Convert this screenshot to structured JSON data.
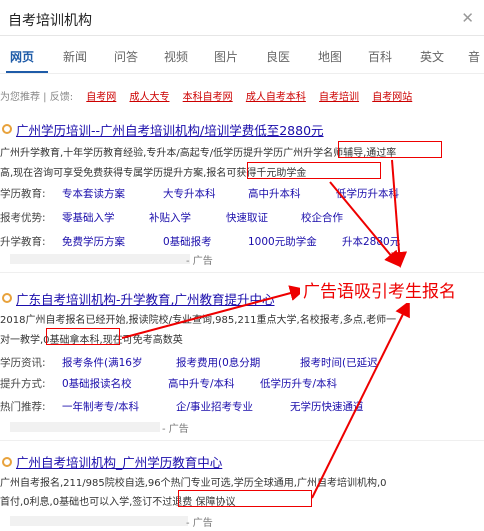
{
  "search": {
    "query": "自考培训机构",
    "clear_icon": "close-icon"
  },
  "tabs": [
    "网页",
    "新闻",
    "问答",
    "视频",
    "图片",
    "良医",
    "地图",
    "百科",
    "英文",
    "音"
  ],
  "recommend": {
    "label": "为您推荐 | 反馈:",
    "items": [
      "自考网",
      "成人大专",
      "本科自考网",
      "成人自考本科",
      "自考培训",
      "自考网站"
    ]
  },
  "results": [
    {
      "title": "广州学历培训--广州自考培训机构/培训学费低至2880元",
      "snip1": "广州升学教育,十年学历教育经验,专升本/高起专/低学历提升学历广州升学名师辅导,通过率",
      "snip2": "高,现在咨询可享受免费获得专属学历提升方案,报名可获得千元助学金",
      "rows": [
        {
          "label": "学历教育:",
          "links": [
            "专本套读方案",
            "大专升本科",
            "高中升本科",
            "低学历升本科"
          ]
        },
        {
          "label": "报考优势:",
          "links": [
            "零基础入学",
            "补贴入学",
            "快速取证",
            "校企合作"
          ]
        },
        {
          "label": "升学教育:",
          "links": [
            "免费学历方案",
            "0基础报考",
            "1000元助学金",
            "升本2880元"
          ]
        }
      ],
      "footer": "- 广告"
    },
    {
      "title": "广东自考培训机构-升学教育,广州教育提升中心",
      "snip1": "2018广州自考报名已经开始,报读院校/专业查询,985,211重点大学,名校报考,多点,老师一",
      "snip2": "对一教学,0基础拿本科,现在可免考高数英",
      "rows": [
        {
          "label": "学历资讯:",
          "links": [
            "报考条件(满16岁",
            "报考费用(0息分期",
            "报考时间(已延迟"
          ]
        },
        {
          "label": "提升方式:",
          "links": [
            "0基础报读名校",
            "高中升专/本科",
            "低学历升专/本科"
          ]
        },
        {
          "label": "热门推荐:",
          "links": [
            "一年制考专/本科",
            "企/事业招考专业",
            "无学历快速通道"
          ]
        }
      ],
      "footer": "- 广告"
    },
    {
      "title": "广州自考培训机构_广州学历教育中心",
      "snip1": "广州自考报名,211/985院校自选,96个热门专业可选,学历全球通用,广州自考培训机构,0",
      "snip2": "首付,0利息,0基础也可以入学,签订不过退费 保障协议",
      "footer": "- 广告"
    }
  ],
  "annotation": "广告语吸引考生报名",
  "colors": {
    "link": "#1a0dab",
    "accent": "#1e5ba8",
    "highlight": "#e00000"
  }
}
